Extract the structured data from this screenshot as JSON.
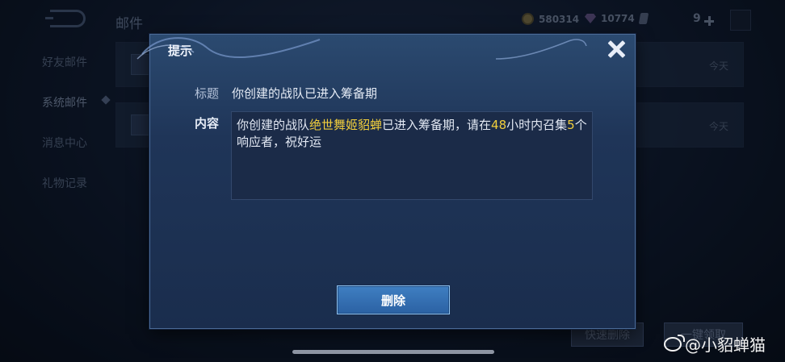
{
  "header": {
    "title": "邮件",
    "gold": "580314",
    "diamonds": "10774",
    "level": "9"
  },
  "sidebar": {
    "items": [
      {
        "label": "好友邮件"
      },
      {
        "label": "系统邮件"
      },
      {
        "label": "消息中心"
      },
      {
        "label": "礼物记录"
      }
    ]
  },
  "mail_list": [
    {
      "date": "今天"
    },
    {
      "date": "今天"
    }
  ],
  "footer": {
    "quick_delete_label": "快速删除",
    "claim_all_label": "一键领取"
  },
  "dialog": {
    "title": "提示",
    "subject_label": "标题",
    "subject": "你创建的战队已进入筹备期",
    "content_label": "内容",
    "content_parts": {
      "p1": "你创建的战队",
      "team_name": "绝世舞姬貂蝉",
      "p2": "已进入筹备期，请在",
      "hours": "48",
      "p3": "小时内召集",
      "count": "5",
      "p4": "个响应者，祝好运"
    },
    "delete_label": "删除"
  },
  "watermark": "@小貂蝉猫",
  "colors": {
    "highlight": "#f2cf3c",
    "primary_button": "#3f7fc2"
  }
}
